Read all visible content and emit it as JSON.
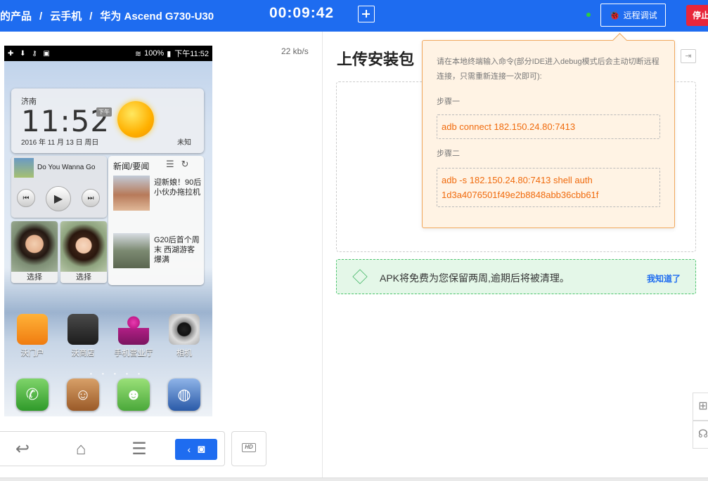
{
  "header": {
    "breadcrumb": [
      "的产品",
      "云手机",
      "华为 Ascend G730-U30"
    ],
    "separator": "/",
    "timer": "00:09:42",
    "remote_debug_label": "远程调试",
    "stop_label": "停止"
  },
  "phone": {
    "speed": "22 kb/s",
    "status": {
      "battery_pct": "100%",
      "time": "下午11:52"
    },
    "clock_widget": {
      "city": "济南",
      "time": "11:52",
      "ampm": "下午",
      "date": "2016 年 11 月 13 日 周日",
      "weather": "未知"
    },
    "music_widget": {
      "song": "Do You Wanna Go"
    },
    "contacts": [
      {
        "label": "选择"
      },
      {
        "label": "选择"
      }
    ],
    "news_widget": {
      "heading": "新闻/要闻",
      "items": [
        {
          "text": "迎新娘！90后小伙办拖拉机"
        },
        {
          "text": "G20后首个周末 西湖游客爆满"
        }
      ]
    },
    "apps": [
      {
        "label": "沃门户",
        "icon": "wo-portal-icon"
      },
      {
        "label": "沃商店",
        "icon": "wo-store-icon"
      },
      {
        "label": "手机营业厅",
        "icon": "business-hall-icon"
      },
      {
        "label": "相机",
        "icon": "camera-icon"
      }
    ],
    "dock": [
      "phone-icon",
      "contacts-icon",
      "messages-icon",
      "browser-icon"
    ]
  },
  "controls": {
    "hd_label": "HD"
  },
  "upload": {
    "title": "上传安装包",
    "notice": "APK将免费为您保留两周,逾期后将被清理。",
    "notice_ack": "我知道了"
  },
  "debug_popover": {
    "tip": "请在本地终端输入命令(部分IDE进入debug模式后会主动切断远程连接，只需重新连接一次即可):",
    "step1_label": "步骤一",
    "step1_cmd": "adb connect 182.150.24.80:7413",
    "step2_label": "步骤二",
    "step2_cmd": "adb -s 182.150.24.80:7413 shell auth 1d3a4076501f49e2b8848abb36cbb61f"
  },
  "colors": {
    "primary": "#1e6cf0",
    "danger": "#e8263a",
    "command": "#f06a0c",
    "success": "#3fb463"
  }
}
